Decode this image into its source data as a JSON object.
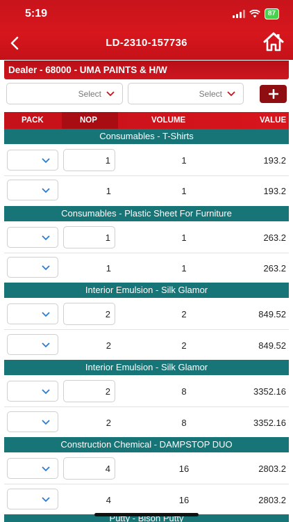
{
  "status_bar": {
    "time": "5:19",
    "battery": "87"
  },
  "nav": {
    "title": "LD-2310-157736"
  },
  "dealer": {
    "label": "Dealer - 68000 - UMA PAINTS & H/W"
  },
  "filters": {
    "select1": "Select",
    "select2": "Select"
  },
  "columns": {
    "pack": "PACK",
    "nop": "NOP",
    "volume": "VOLUME",
    "value": "VALUE"
  },
  "sections": [
    {
      "title": "Consumables - T-Shirts",
      "rows": [
        {
          "nop": "1",
          "volume": "1",
          "value": "193.2"
        },
        {
          "nop": "1",
          "volume": "1",
          "value": "193.2"
        }
      ]
    },
    {
      "title": "Consumables - Plastic Sheet For Furniture",
      "rows": [
        {
          "nop": "1",
          "volume": "1",
          "value": "263.2"
        },
        {
          "nop": "1",
          "volume": "1",
          "value": "263.2"
        }
      ]
    },
    {
      "title": "Interior Emulsion - Silk Glamor",
      "rows": [
        {
          "nop": "2",
          "volume": "2",
          "value": "849.52"
        },
        {
          "nop": "2",
          "volume": "2",
          "value": "849.52"
        }
      ]
    },
    {
      "title": "Interior Emulsion - Silk Glamor",
      "rows": [
        {
          "nop": "2",
          "volume": "8",
          "value": "3352.16"
        },
        {
          "nop": "2",
          "volume": "8",
          "value": "3352.16"
        }
      ]
    },
    {
      "title": "Construction Chemical - DAMPSTOP DUO",
      "rows": [
        {
          "nop": "4",
          "volume": "16",
          "value": "2803.2"
        },
        {
          "nop": "4",
          "volume": "16",
          "value": "2803.2"
        }
      ]
    },
    {
      "title": "Putty - Bison Putty",
      "rows": []
    }
  ],
  "colors": {
    "brand_red": "#d7161d",
    "section_teal": "#177577",
    "add_button": "#8e0e12",
    "chevron_blue": "#2a7bd4"
  },
  "icons": {
    "back": "chevron-left-icon",
    "home": "home-icon",
    "add": "plus-icon",
    "dropdown": "chevron-down-icon"
  }
}
